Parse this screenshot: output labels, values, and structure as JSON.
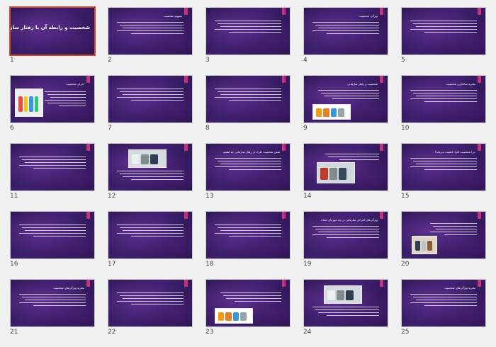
{
  "slides": [
    {
      "n": "1",
      "title": "شخصیت و رابطه آن با رفتار سازمانی",
      "kind": "title"
    },
    {
      "n": "2",
      "title": "مفهوم شخصیت",
      "kind": "text"
    },
    {
      "n": "3",
      "title": "",
      "kind": "text"
    },
    {
      "n": "4",
      "title": "ویژگی شخصیت",
      "kind": "text"
    },
    {
      "n": "5",
      "title": "",
      "kind": "text"
    },
    {
      "n": "6",
      "title": "اجزای شخصیت",
      "kind": "image-left"
    },
    {
      "n": "7",
      "title": "",
      "kind": "text"
    },
    {
      "n": "8",
      "title": "",
      "kind": "text"
    },
    {
      "n": "9",
      "title": "شخصیت و رفتار سازمانی",
      "kind": "image-bottom"
    },
    {
      "n": "10",
      "title": "نظریه ساختاری شخصیت",
      "kind": "text"
    },
    {
      "n": "11",
      "title": "",
      "kind": "text"
    },
    {
      "n": "12",
      "title": "",
      "kind": "image-top"
    },
    {
      "n": "13",
      "title": "نقش شخصیت افراد در رفتار سازمانی چه اهمیتی دارد؟",
      "kind": "text"
    },
    {
      "n": "14",
      "title": "",
      "kind": "image-bottom-left"
    },
    {
      "n": "15",
      "title": "چرا شخصیت افراد اهمیت می‌یابد؟",
      "kind": "text"
    },
    {
      "n": "16",
      "title": "",
      "kind": "text"
    },
    {
      "n": "17",
      "title": "",
      "kind": "text"
    },
    {
      "n": "18",
      "title": "",
      "kind": "text"
    },
    {
      "n": "19",
      "title": "ویژگی‌های افرادی سازمانی در چه حوزه‌ای شناخته می‌شود؟",
      "kind": "text"
    },
    {
      "n": "20",
      "title": "",
      "kind": "image-left-mid"
    },
    {
      "n": "21",
      "title": "نظریه‌ ویژگی‌های شخصیت",
      "kind": "text"
    },
    {
      "n": "22",
      "title": "",
      "kind": "text"
    },
    {
      "n": "23",
      "title": "",
      "kind": "image-bottom"
    },
    {
      "n": "24",
      "title": "",
      "kind": "image-top"
    },
    {
      "n": "25",
      "title": "نظریه ویژگی‌های شخصیت",
      "kind": "text"
    }
  ],
  "selected": "1",
  "accent_color": "#c8307a",
  "selection_color": "#d24726"
}
